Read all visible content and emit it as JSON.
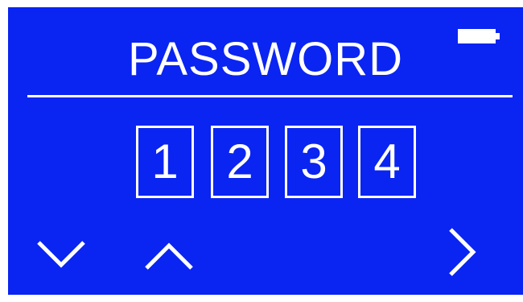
{
  "screen": {
    "title": "PASSWORD",
    "background_color": "#0a24f2",
    "foreground_color": "#ffffff"
  },
  "status": {
    "battery_icon": "battery-full-icon"
  },
  "password": {
    "digits": [
      "1",
      "2",
      "3",
      "4"
    ]
  },
  "controls": {
    "down_icon": "chevron-down-icon",
    "up_icon": "chevron-up-icon",
    "next_icon": "chevron-right-icon"
  }
}
